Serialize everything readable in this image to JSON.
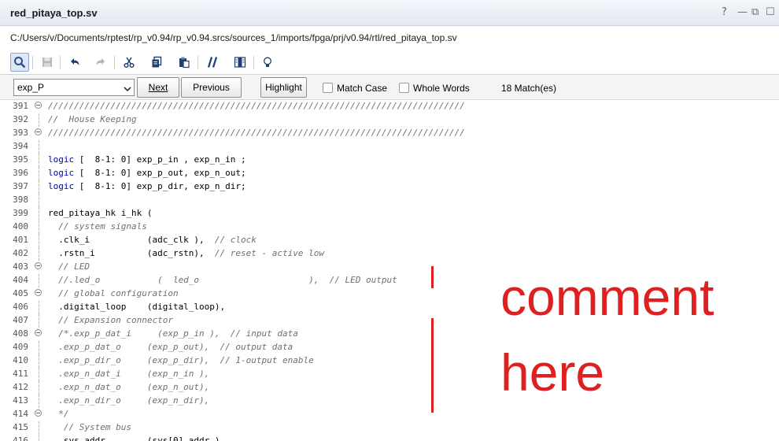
{
  "window": {
    "title": "red_pitaya_top.sv",
    "path": "C:/Users/v/Documents/rptest/rp_v0.94/rp_v0.94.srcs/sources_1/imports/fpga/prj/v0.94/rtl/red_pitaya_top.sv",
    "controls": [
      "?",
      "—",
      "⧉",
      "☐"
    ]
  },
  "toolbar": {
    "icons": [
      "search-icon",
      "save-icon",
      "undo-icon",
      "redo-icon",
      "cut-icon",
      "copy-icon",
      "paste-icon",
      "comment-icon",
      "column-icon",
      "bulb-icon"
    ]
  },
  "find": {
    "query": "exp_P",
    "next_label": "Next",
    "previous_label": "Previous",
    "highlight_label": "Highlight",
    "match_case_label": "Match Case",
    "whole_words_label": "Whole Words",
    "match_count": "18 Match(es)",
    "match_case_checked": false,
    "whole_words_checked": false
  },
  "code_lines": [
    {
      "num": "391",
      "text": "////////////////////////////////////////////////////////////////////////////////",
      "type": "cmt",
      "fold": true
    },
    {
      "num": "392",
      "text": "//  House Keeping",
      "type": "cmt",
      "fold": false
    },
    {
      "num": "393",
      "text": "////////////////////////////////////////////////////////////////////////////////",
      "type": "cmt",
      "fold": true
    },
    {
      "num": "394",
      "text": "",
      "type": "code",
      "fold": false
    },
    {
      "num": "395",
      "text": "logic [  8-1: 0] exp_p_in , exp_n_in ;",
      "type": "kw",
      "fold": false
    },
    {
      "num": "396",
      "text": "logic [  8-1: 0] exp_p_out, exp_n_out;",
      "type": "kw",
      "fold": false
    },
    {
      "num": "397",
      "text": "logic [  8-1: 0] exp_p_dir, exp_n_dir;",
      "type": "kw",
      "fold": false
    },
    {
      "num": "398",
      "text": "",
      "type": "code",
      "fold": false
    },
    {
      "num": "399",
      "text": "red_pitaya_hk i_hk (",
      "type": "code",
      "fold": false
    },
    {
      "num": "400",
      "text": "  // system signals",
      "type": "cmt",
      "fold": false
    },
    {
      "num": "401",
      "text": "  .clk_i           (adc_clk ),  // clock",
      "type": "mixed",
      "fold": false,
      "split": 32
    },
    {
      "num": "402",
      "text": "  .rstn_i          (adc_rstn),  // reset - active low",
      "type": "mixed",
      "fold": false,
      "split": 32
    },
    {
      "num": "403",
      "text": "  // LED",
      "type": "cmt",
      "fold": true
    },
    {
      "num": "404",
      "text": "  //.led_o           (  led_o                     ),  // LED output",
      "type": "cmt",
      "fold": false
    },
    {
      "num": "405",
      "text": "  // global configuration",
      "type": "cmt",
      "fold": true
    },
    {
      "num": "406",
      "text": "  .digital_loop    (digital_loop),",
      "type": "code",
      "fold": false
    },
    {
      "num": "407",
      "text": "  // Expansion connector",
      "type": "cmt",
      "fold": false
    },
    {
      "num": "408",
      "text": "  /*.exp_p_dat_i     (exp_p_in ),  // input data",
      "type": "cmt",
      "fold": true
    },
    {
      "num": "409",
      "text": "  .exp_p_dat_o     (exp_p_out),  // output data",
      "type": "cmt",
      "fold": false
    },
    {
      "num": "410",
      "text": "  .exp_p_dir_o     (exp_p_dir),  // 1-output enable",
      "type": "cmt",
      "fold": false
    },
    {
      "num": "411",
      "text": "  .exp_n_dat_i     (exp_n_in ),",
      "type": "cmt",
      "fold": false
    },
    {
      "num": "412",
      "text": "  .exp_n_dat_o     (exp_n_out),",
      "type": "cmt",
      "fold": false
    },
    {
      "num": "413",
      "text": "  .exp_n_dir_o     (exp_n_dir),",
      "type": "cmt",
      "fold": false
    },
    {
      "num": "414",
      "text": "  */",
      "type": "cmt",
      "fold": true
    },
    {
      "num": "415",
      "text": "   // System bus",
      "type": "cmt",
      "fold": false
    },
    {
      "num": "416",
      "text": "  .sys_addr        (sys[0].addr ),",
      "type": "code",
      "fold": false
    }
  ],
  "annotation": {
    "line1": "comment",
    "line2": "here",
    "color": "#e02020"
  },
  "colors": {
    "keyword": "#0000b0",
    "comment": "#6f6f6f",
    "accent": "#dde8f7"
  }
}
